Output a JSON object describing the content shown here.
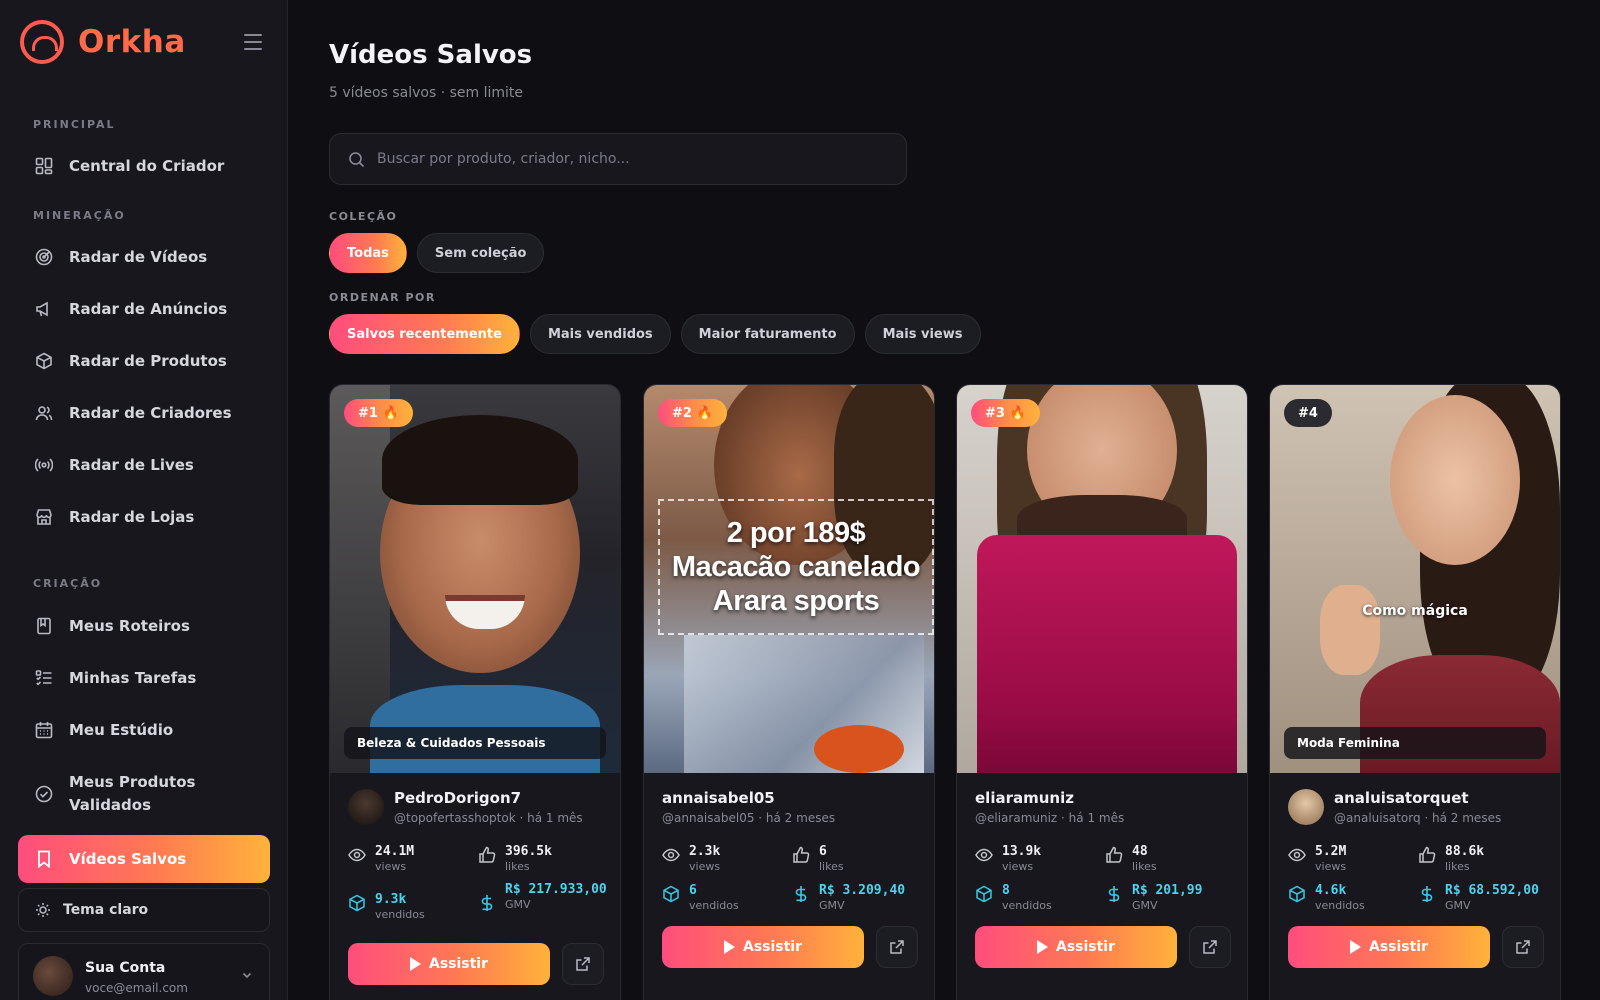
{
  "app": {
    "brand": "Orkha"
  },
  "sidebar": {
    "sections": {
      "principal": "PRINCIPAL",
      "mineracao": "MINERAÇÃO",
      "criacao": "CRIAÇÃO"
    },
    "items": [
      {
        "label": "Central do Criador",
        "icon": "grid-icon"
      },
      {
        "label": "Radar de Vídeos",
        "icon": "radar-icon"
      },
      {
        "label": "Radar de Anúncios",
        "icon": "megaphone-icon"
      },
      {
        "label": "Radar de Produtos",
        "icon": "box-icon"
      },
      {
        "label": "Radar de Criadores",
        "icon": "users-icon"
      },
      {
        "label": "Radar de Lives",
        "icon": "broadcast-icon"
      },
      {
        "label": "Radar de Lojas",
        "icon": "store-icon"
      },
      {
        "label": "Meus Roteiros",
        "icon": "book-icon"
      },
      {
        "label": "Minhas Tarefas",
        "icon": "checklist-icon"
      },
      {
        "label": "Meu Estúdio",
        "icon": "calendar-icon"
      },
      {
        "label": "Meus Produtos Validados",
        "icon": "check-circle-icon"
      },
      {
        "label": "Vídeos Salvos",
        "icon": "bookmark-icon",
        "active": true
      }
    ],
    "theme_toggle": "Tema claro",
    "account": {
      "name": "Sua Conta",
      "email": "voce@email.com"
    }
  },
  "main": {
    "title": "Vídeos Salvos",
    "subtitle": "5 vídeos salvos · sem limite",
    "search": {
      "placeholder": "Buscar por produto, criador, nicho..."
    },
    "collection": {
      "label": "COLEÇÃO",
      "chips": [
        "Todas",
        "Sem coleção"
      ],
      "active": "Todas"
    },
    "sort": {
      "label": "ORDENAR POR",
      "chips": [
        "Salvos recentemente",
        "Mais vendidos",
        "Maior faturamento",
        "Mais views"
      ],
      "active": "Salvos recentemente"
    }
  },
  "cards": [
    {
      "rank": "#1",
      "category": "Beleza & Cuidados Pessoais",
      "creator": "PedroDorigon7",
      "handle": "@topofertasshoptok · há 1 mês",
      "views": "24.1M",
      "views_label": "views",
      "likes": "396.5k",
      "likes_label": "likes",
      "sold": "9.3k",
      "sold_label": "vendidos",
      "gmv": "R$ 217.933,00",
      "gmv_label": "GMV",
      "watch": "Assistir"
    },
    {
      "rank": "#2",
      "overlay": [
        "2 por 189$",
        "Macacão canelado",
        "Arara sports"
      ],
      "creator": "annaisabel05",
      "handle": "@annaisabel05 · há 2 meses",
      "views": "2.3k",
      "views_label": "views",
      "likes": "6",
      "likes_label": "likes",
      "sold": "6",
      "sold_label": "vendidos",
      "gmv": "R$ 3.209,40",
      "gmv_label": "GMV",
      "watch": "Assistir"
    },
    {
      "rank": "#3",
      "creator": "eliaramuniz",
      "handle": "@eliaramuniz · há 1 mês",
      "views": "13.9k",
      "views_label": "views",
      "likes": "48",
      "likes_label": "likes",
      "sold": "8",
      "sold_label": "vendidos",
      "gmv": "R$ 201,99",
      "gmv_label": "GMV",
      "watch": "Assistir"
    },
    {
      "rank": "#4",
      "caption": "Como mágica",
      "category": "Moda Feminina",
      "creator": "analuisatorquet",
      "handle": "@analuisatorq · há 2 meses",
      "views": "5.2M",
      "views_label": "views",
      "likes": "88.6k",
      "likes_label": "likes",
      "sold": "4.6k",
      "sold_label": "vendidos",
      "gmv": "R$ 68.592,00",
      "gmv_label": "GMV",
      "watch": "Assistir"
    }
  ],
  "colors": {
    "accent_gradient_start": "#ff4d7d",
    "accent_gradient_mid": "#ff7a52",
    "accent_gradient_end": "#ffb23b",
    "teal": "#4fd2ee",
    "background": "#0f0f13"
  }
}
